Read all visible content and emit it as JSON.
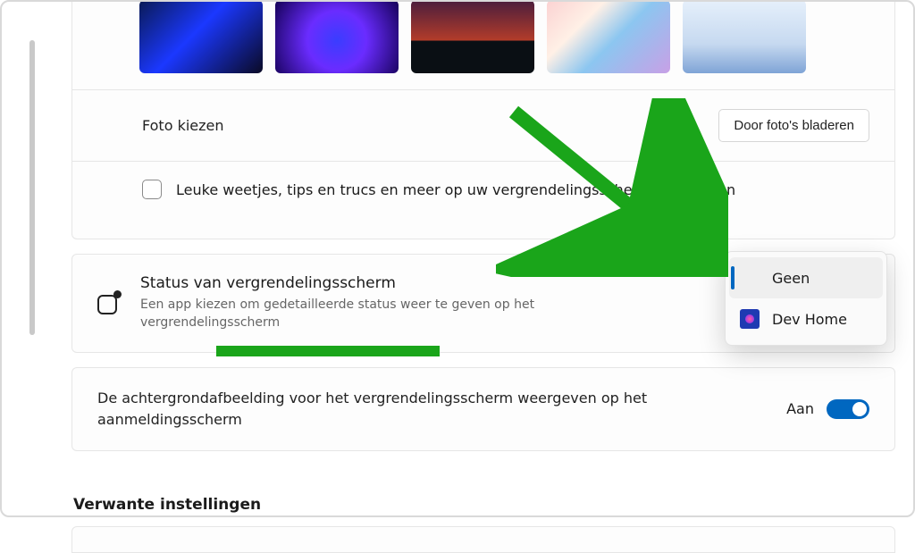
{
  "photo_row": {
    "label": "Foto kiezen",
    "browse": "Door foto's bladeren"
  },
  "tips_checkbox": {
    "label": "Leuke weetjes, tips en trucs en meer op uw vergrendelingsscherm weergeven"
  },
  "status": {
    "title": "Status van vergrendelingsscherm",
    "subtitle": "Een app kiezen om gedetailleerde status weer te geven op het vergrendelingsscherm"
  },
  "flyout": {
    "none": "Geen",
    "devhome": "Dev Home"
  },
  "signin": {
    "label": "De achtergrondafbeelding voor het vergrendelingsscherm weergeven op het aanmeldingsscherm",
    "state": "Aan"
  },
  "related_heading": "Verwante instellingen"
}
